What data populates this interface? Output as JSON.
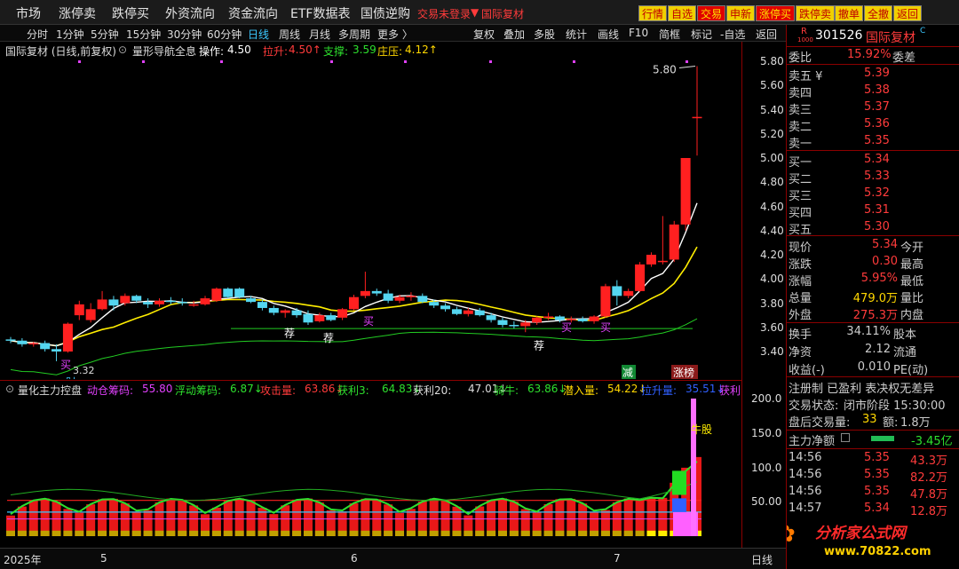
{
  "menubar": {
    "items": [
      "市场",
      "涨停卖",
      "跌停买",
      "外资流向",
      "资金流向",
      "ETF数据表",
      "国债逆购"
    ],
    "alert": "交易未登录",
    "stock_tag": "国际复材",
    "buttons": [
      "行情",
      "自选",
      "交易",
      "申新",
      "涨停买",
      "跌停卖",
      "撤单",
      "全撤",
      "返回"
    ]
  },
  "period_bar": {
    "items": [
      "分时",
      "1分钟",
      "5分钟",
      "15分钟",
      "30分钟",
      "60分钟",
      "日线",
      "周线",
      "月线",
      "多周期",
      "更多 〉"
    ],
    "active": "日线",
    "tools": [
      "复权",
      "叠加",
      "多股",
      "统计",
      "画线",
      "F10",
      "简框",
      "标记",
      "-自选",
      "返回"
    ]
  },
  "chart_title": {
    "name": "国际复材 (日线,前复权)",
    "indicator": "量形导航全息",
    "op_label": "操作:",
    "op_value": "4.50",
    "pull_label": "拉升:",
    "pull_value": "4.50↑",
    "support_label": "支撑:",
    "support_value": "3.59",
    "press_label": "庄压:",
    "press_value": "4.12↑"
  },
  "annotations": {
    "high_label": "5.80",
    "low_label": "3.32",
    "cai": "财",
    "mai": "买",
    "jian": "减",
    "zhangbang": "涨榜",
    "jian_tui": [
      "荐",
      "荐",
      "荐"
    ],
    "niugu": "牛股"
  },
  "yaxis_ticks": [
    "5.80",
    "5.60",
    "5.40",
    "5.20",
    "5.00",
    "4.80",
    "4.60",
    "4.40",
    "4.20",
    "4.00",
    "3.80",
    "3.60",
    "3.40"
  ],
  "ind_yaxis_ticks": [
    "200.0",
    "150.0",
    "100.0",
    "50.00"
  ],
  "ind_title": {
    "name": "量化主力控盘",
    "items": [
      {
        "label": "动仓筹码:",
        "value": "55.80",
        "color": "#e040fb"
      },
      {
        "label": "浮动筹码:",
        "value": "6.87↓",
        "color": "#2ee02e"
      },
      {
        "label": "攻击量:",
        "value": "63.86↓",
        "color": "#ff3b3b"
      },
      {
        "label": "获利3:",
        "value": "64.83↓",
        "color": "#2ee02e"
      },
      {
        "label": "获利20:",
        "value": "47.01↓",
        "color": "#ddd"
      },
      {
        "label": "骑牛:",
        "value": "63.86↓",
        "color": "#2ee02e"
      },
      {
        "label": "潜入量:",
        "value": "54.22↓",
        "color": "#ffd700"
      },
      {
        "label": "拉升量:",
        "value": "35.51↓",
        "color": "#3060ff"
      },
      {
        "label": "获利",
        "value": "",
        "color": "#e040fb"
      }
    ]
  },
  "xaxis": {
    "labels": [
      "2025年",
      "5",
      "6",
      "7"
    ],
    "right": "日线"
  },
  "right_panel": {
    "code": "301526",
    "name": "国际复材",
    "badge": "R",
    "badge_sub": "1000",
    "weibi_label": "委比",
    "weibi_value": "15.92%",
    "weicha_label": "委差",
    "sell": [
      {
        "label": "卖五 ¥",
        "price": "5.39"
      },
      {
        "label": "卖四",
        "price": "5.38"
      },
      {
        "label": "卖三",
        "price": "5.37"
      },
      {
        "label": "卖二",
        "price": "5.36"
      },
      {
        "label": "卖一",
        "price": "5.35"
      }
    ],
    "buy": [
      {
        "label": "买一",
        "price": "5.34"
      },
      {
        "label": "买二",
        "price": "5.33"
      },
      {
        "label": "买三",
        "price": "5.32"
      },
      {
        "label": "买四",
        "price": "5.31"
      },
      {
        "label": "买五",
        "price": "5.30"
      }
    ],
    "quote": [
      {
        "label": "现价",
        "value": "5.34",
        "color": "#ff3b3b",
        "label2": "今开"
      },
      {
        "label": "涨跌",
        "value": "0.30",
        "color": "#ff3b3b",
        "label2": "最高"
      },
      {
        "label": "涨幅",
        "value": "5.95%",
        "color": "#ff3b3b",
        "label2": "最低"
      },
      {
        "label": "总量",
        "value": "479.0万",
        "color": "#ffd700",
        "label2": "量比"
      },
      {
        "label": "外盘",
        "value": "275.3万",
        "color": "#ff3b3b",
        "label2": "内盘"
      }
    ],
    "quote2": [
      {
        "label": "换手",
        "value": "34.11%",
        "label2": "股本"
      },
      {
        "label": "净资",
        "value": "2.12",
        "label2": "流通"
      },
      {
        "label": "收益(-)",
        "value": "0.010",
        "label2": "PE(动)"
      }
    ],
    "reg": "注册制 已盈利 表决权无差异",
    "trade_state_label": "交易状态:",
    "trade_state_value": "闭市阶段 15:30:00",
    "after_label": "盘后交易量:",
    "after_value": "33",
    "after_amt_label": "额:",
    "after_amt_value": "1.8万",
    "netflow_label": "主力净额",
    "netflow_value": "-3.45亿",
    "ticks": [
      {
        "time": "14:56",
        "price": "5.35",
        "vol": "43.3万"
      },
      {
        "time": "14:56",
        "price": "5.35",
        "vol": "82.2万"
      },
      {
        "time": "14:56",
        "price": "5.35",
        "vol": "47.8万"
      },
      {
        "time": "14:57",
        "price": "5.34",
        "vol": "12.8万"
      }
    ],
    "watermark": "分析家公式网",
    "watermark_url": "www.70822.com"
  },
  "colors": {
    "up": "#ff2020",
    "down": "#54d6f0",
    "ma_white": "#ffffff",
    "ma_yellow": "#ffee00",
    "ma_green": "#22cc22"
  }
}
